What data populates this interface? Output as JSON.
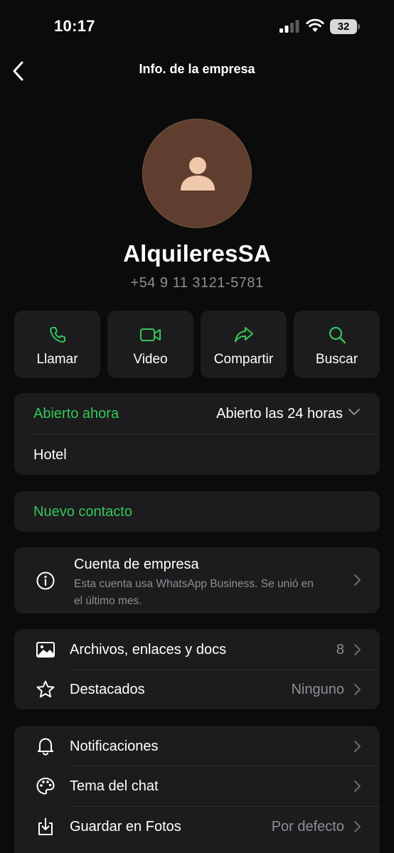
{
  "status_bar": {
    "time": "10:17",
    "battery": "32"
  },
  "nav": {
    "title": "Info. de la empresa"
  },
  "profile": {
    "name": "AlquileresSA",
    "phone": "+54 9 11 3121-5781"
  },
  "actions": [
    {
      "label": "Llamar",
      "icon": "phone-icon"
    },
    {
      "label": "Video",
      "icon": "video-icon"
    },
    {
      "label": "Compartir",
      "icon": "share-icon"
    },
    {
      "label": "Buscar",
      "icon": "search-icon"
    }
  ],
  "hours_card": {
    "status": "Abierto ahora",
    "hours": "Abierto las 24 horas",
    "category": "Hotel"
  },
  "new_contact": {
    "label": "Nuevo contacto"
  },
  "business_account": {
    "title": "Cuenta de empresa",
    "description_line1": "Esta cuenta usa WhatsApp Business. Se unió en",
    "description_line2": "el último mes."
  },
  "media_card": {
    "files_label": "Archivos, enlaces y docs",
    "files_count": "8",
    "starred_label": "Destacados",
    "starred_value": "Ninguno"
  },
  "settings_card": {
    "notifications_label": "Notificaciones",
    "theme_label": "Tema del chat",
    "save_label": "Guardar en Fotos",
    "save_value": "Por defecto"
  },
  "colors": {
    "accent": "#35c759",
    "background": "#0b0b0b",
    "card": "#1c1c1e",
    "secondary_text": "#8e8e93",
    "avatar": "#5f3e2f"
  }
}
